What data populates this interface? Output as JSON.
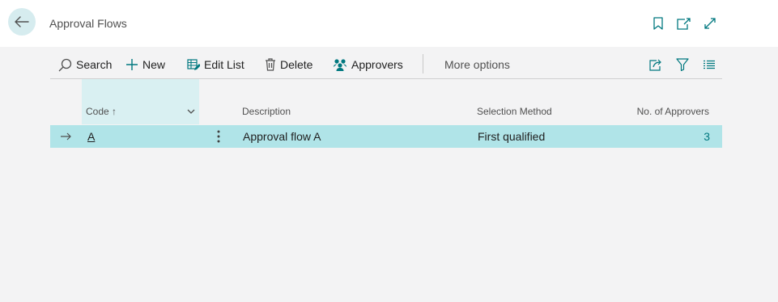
{
  "header": {
    "title": "Approval Flows",
    "icons": [
      "back-arrow-icon",
      "bookmark-icon",
      "open-new-window-icon",
      "expand-icon"
    ]
  },
  "toolbar": {
    "search_label": "Search",
    "new_label": "New",
    "edit_list_label": "Edit List",
    "delete_label": "Delete",
    "approvers_label": "Approvers",
    "more_options_label": "More options"
  },
  "grid": {
    "columns": {
      "code": "Code",
      "code_sort": "↑",
      "description": "Description",
      "selection_method": "Selection Method",
      "no_of_approvers": "No. of Approvers"
    },
    "rows": [
      {
        "code": "A",
        "description": "Approval flow A",
        "selection_method": "First qualified",
        "no_of_approvers": "3"
      }
    ]
  },
  "colors": {
    "accent": "#00787f",
    "selected_row": "#b0e4e8",
    "sorted_column": "#d9f0f2",
    "back_button": "#d6ecef"
  }
}
